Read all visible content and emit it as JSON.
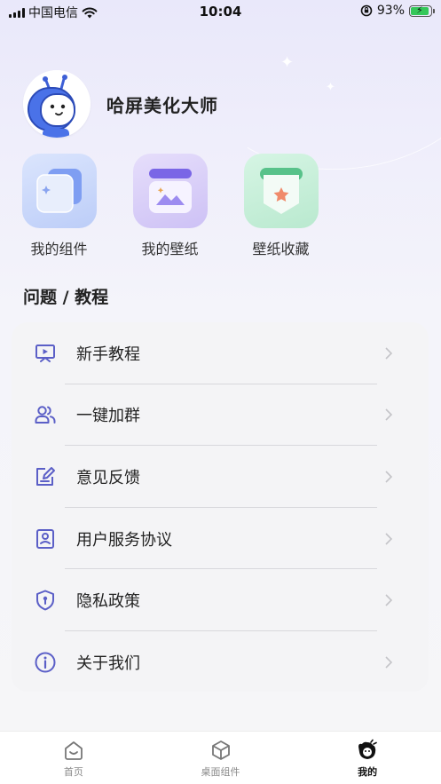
{
  "status_bar": {
    "carrier": "中国电信",
    "time": "10:04",
    "battery": "93%"
  },
  "profile": {
    "name": "哈屏美化大师"
  },
  "tiles": [
    {
      "label": "我的组件",
      "icon": "widget-icon"
    },
    {
      "label": "我的壁纸",
      "icon": "wallpaper-icon"
    },
    {
      "label": "壁纸收藏",
      "icon": "favorite-icon"
    }
  ],
  "section": {
    "title": "问题 / 教程"
  },
  "menu": [
    {
      "label": "新手教程",
      "icon": "tutorial-icon"
    },
    {
      "label": "一键加群",
      "icon": "group-icon"
    },
    {
      "label": "意见反馈",
      "icon": "feedback-icon"
    },
    {
      "label": "用户服务协议",
      "icon": "agreement-icon"
    },
    {
      "label": "隐私政策",
      "icon": "privacy-icon"
    },
    {
      "label": "关于我们",
      "icon": "about-icon"
    }
  ],
  "tabbar": [
    {
      "label": "首页",
      "icon": "home-icon",
      "active": false
    },
    {
      "label": "桌面组件",
      "icon": "box-icon",
      "active": false
    },
    {
      "label": "我的",
      "icon": "mascot-icon",
      "active": true
    }
  ],
  "colors": {
    "accent": "#5b5fc7",
    "tile_blue": "#c9d7fb",
    "tile_purple": "#d9d0f7",
    "tile_green": "#c9efdb"
  }
}
